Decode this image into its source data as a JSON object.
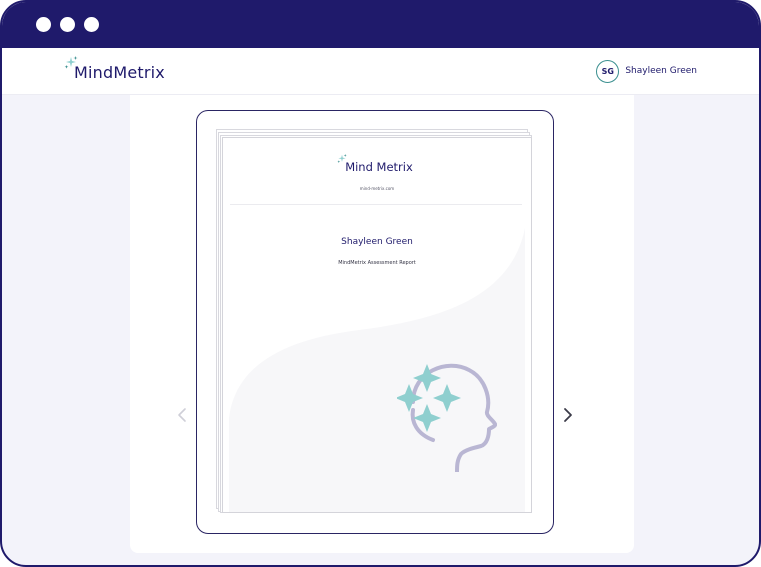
{
  "window": {
    "controls": [
      "window-dot",
      "window-dot",
      "window-dot"
    ]
  },
  "header": {
    "brand": "MindMetrix",
    "user": {
      "initials": "SG",
      "name": "Shayleen Green"
    }
  },
  "viewer": {
    "prev_icon": "chevron-left-icon",
    "next_icon": "chevron-right-icon"
  },
  "report": {
    "brand": "Mind Metrix",
    "url": "mind-metrix.com",
    "person_name": "Shayleen Green",
    "subtitle": "MindMetrix Assessment Report",
    "illustration_icon": "head-sparkles-icon"
  },
  "colors": {
    "navy": "#1f1a6b",
    "teal": "#3a8f8f",
    "sparkle": "#8fcfcf",
    "lavender": "#b9b6d3",
    "panel": "#f3f3fa"
  }
}
